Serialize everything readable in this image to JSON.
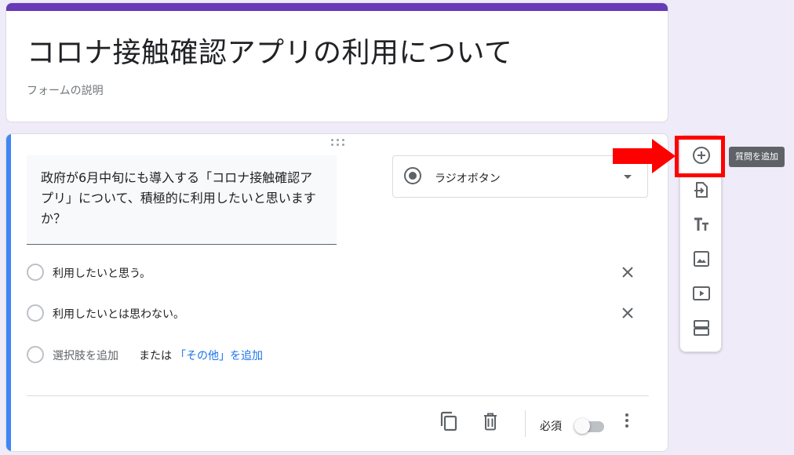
{
  "form": {
    "title": "コロナ接触確認アプリの利用について",
    "description_placeholder": "フォームの説明"
  },
  "question": {
    "text": "政府が6月中旬にも導入する「コロナ接触確認アプリ」について、積極的に利用したいと思いますか？",
    "type_label": "ラジオボタン",
    "options": [
      {
        "label": "利用したいと思う。"
      },
      {
        "label": "利用したいとは思わない。"
      }
    ],
    "add_option_placeholder": "選択肢を追加",
    "or_text": "または",
    "add_other_label": "「その他」を追加",
    "required_label": "必須",
    "required": false
  },
  "toolbar": {
    "tooltip": "質問を追加",
    "items": [
      "add-question",
      "import-questions",
      "add-title-description",
      "add-image",
      "add-video",
      "add-section"
    ]
  },
  "colors": {
    "theme": "#673ab7",
    "active_card": "#4285f4",
    "highlight": "#ff0000",
    "background": "#f0ebf8"
  }
}
